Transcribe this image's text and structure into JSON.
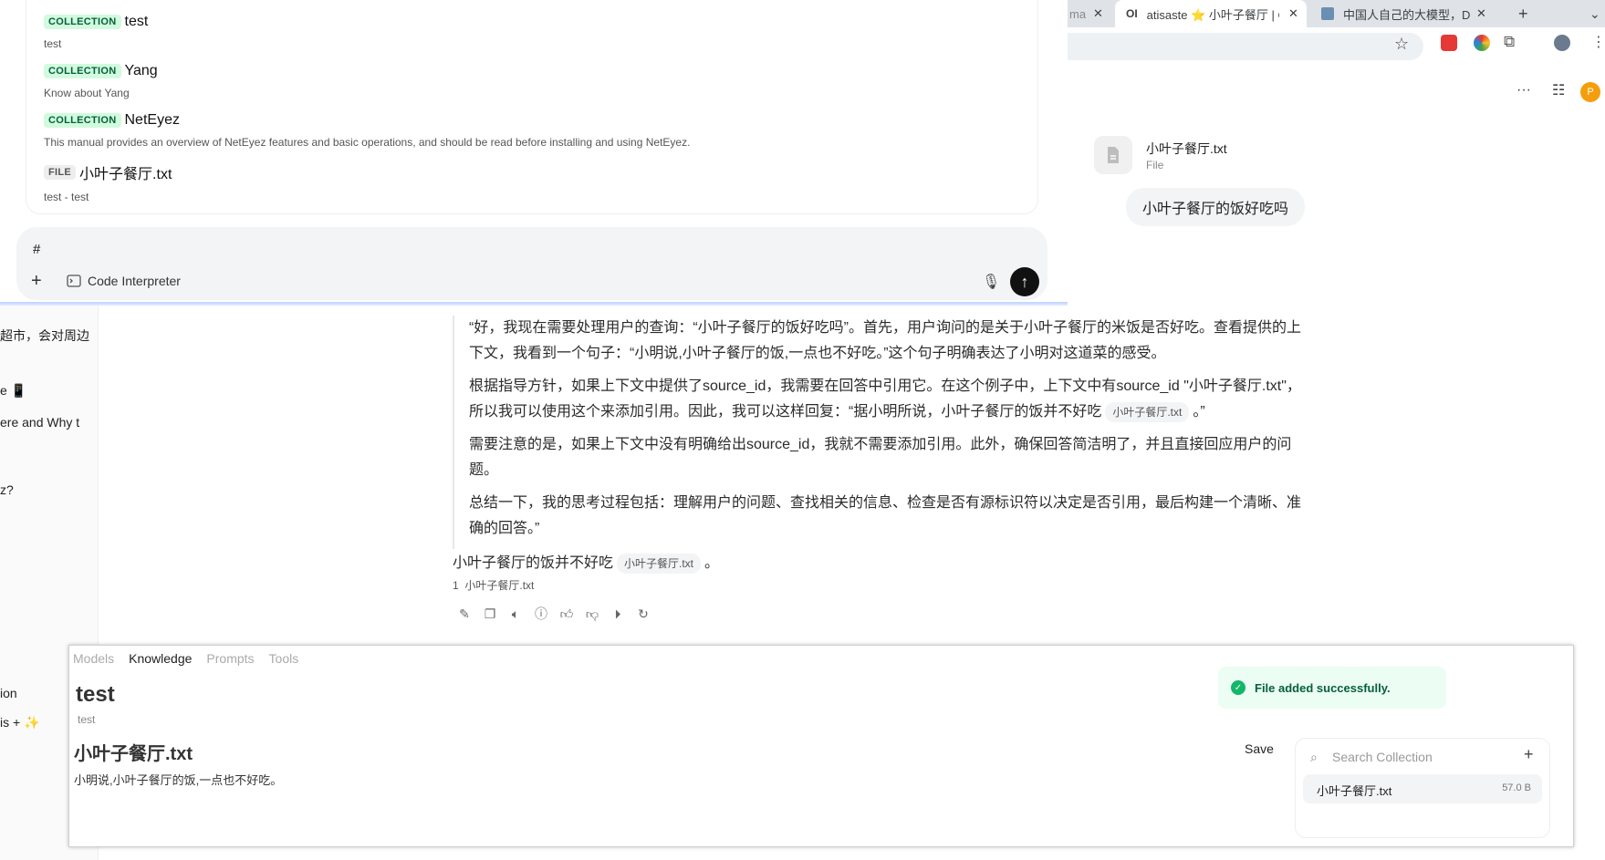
{
  "browser": {
    "tabs": [
      {
        "label": "ma"
      },
      {
        "label": "atisaste ⭐ 小叶子餐厅 | O",
        "prefix": "OI"
      },
      {
        "label": "中国人自己的大模型，Dee"
      }
    ],
    "new_tab": "+",
    "tab_strip_menu": "⌄"
  },
  "sidebar": {
    "items": [
      {
        "label": "超市，会对周边"
      },
      {
        "label": "e 📱"
      },
      {
        "label": "ere and Why t"
      },
      {
        "label": "z?"
      },
      {
        "label": "ion"
      },
      {
        "label": "is + ✨"
      }
    ]
  },
  "dropdown": {
    "items": [
      {
        "type": "COLLECTION",
        "title": "test",
        "description": "test"
      },
      {
        "type": "COLLECTION",
        "title": "Yang",
        "description": "Know about Yang"
      },
      {
        "type": "COLLECTION",
        "title": "NetEyez",
        "description": "This manual provides an overview of NetEyez features and basic operations, and should be read before installing and using NetEyez."
      },
      {
        "type": "FILE",
        "title": "小叶子餐厅.txt",
        "description": "test - test"
      }
    ]
  },
  "chat_input": {
    "value": "#",
    "code_interpreter_label": "Code Interpreter"
  },
  "chat": {
    "file_card": {
      "name": "小叶子餐厅.txt",
      "type": "File"
    },
    "user_message": "小叶子餐厅的饭好吃吗",
    "thinking": {
      "p1": "“好，我现在需要处理用户的查询：“小叶子餐厅的饭好吃吗”。首先，用户询问的是关于小叶子餐厅的米饭是否好吃。查看提供的上下文，我看到一个句子：“小明说,小叶子餐厅的饭,一点也不好吃。”这个句子明确表达了小明对这道菜的感受。",
      "p2_before": "根据指导方针，如果上下文中提供了source_id，我需要在回答中引用它。在这个例子中，上下文中有source_id \"小叶子餐厅.txt\"，所以我可以使用这个来添加引用。因此，我可以这样回复：“据小明所说，小叶子餐厅的饭并不好吃",
      "p2_chip": "小叶子餐厅.txt",
      "p2_after": "。”",
      "p3": "需要注意的是，如果上下文中没有明确给出source_id，我就不需要添加引用。此外，确保回答简洁明了，并且直接回应用户的问题。",
      "p4": "总结一下，我的思考过程包括：理解用户的问题、查找相关的信息、检查是否有源标识符以决定是否引用，最后构建一个清晰、准确的回答。”"
    },
    "answer": {
      "text": "小叶子餐厅的饭并不好吃",
      "chip": "小叶子餐厅.txt",
      "end": "。"
    },
    "citation": {
      "index": "1",
      "source": "小叶子餐厅.txt"
    }
  },
  "workspace": {
    "tabs": [
      {
        "label": "Models",
        "active": false
      },
      {
        "label": "Knowledge",
        "active": true
      },
      {
        "label": "Prompts",
        "active": false
      },
      {
        "label": "Tools",
        "active": false
      }
    ],
    "kb_title": "test",
    "kb_description": "test",
    "doc_title": "小叶子餐厅.txt",
    "doc_content": "小明说,小叶子餐厅的饭,一点也不好吃。",
    "save_label": "Save",
    "collection": {
      "search_placeholder": "Search Collection",
      "files": [
        {
          "name": "小叶子餐厅.txt",
          "size": "57.0 B"
        }
      ]
    }
  },
  "toast": {
    "message": "File added successfully."
  },
  "colors": {
    "accent_green": "#12b76a",
    "collection_tag_bg": "#d1fadf",
    "send_button": "#111111"
  }
}
